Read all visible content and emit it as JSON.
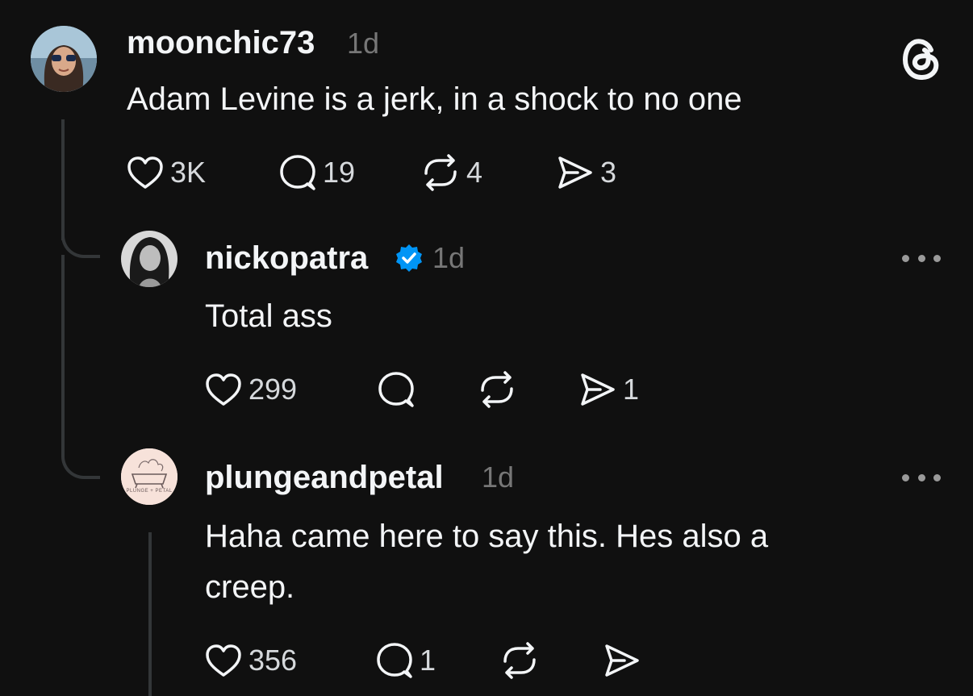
{
  "posts": [
    {
      "username": "moonchic73",
      "time": "1d",
      "text_lines": [
        "Adam Levine is a jerk, in a shock to no one"
      ],
      "likes": "3K",
      "replies": "19",
      "reposts": "4",
      "shares": "3"
    },
    {
      "username": "nickopatra",
      "verified": true,
      "time": "1d",
      "text_lines": [
        "Total ass"
      ],
      "likes": "299",
      "replies": "",
      "reposts": "",
      "shares": "1"
    },
    {
      "username": "plungeandpetal",
      "time": "1d",
      "text_lines": [
        "Haha came here to say this. Hes also a",
        "creep."
      ],
      "likes": "356",
      "replies": "1",
      "reposts": "",
      "shares": ""
    }
  ],
  "avatar_logo_text": "PLUNGE + PETAL",
  "colors": {
    "background": "#101010",
    "text": "#f3f5f7",
    "muted": "#777777",
    "thread_line": "#333638",
    "verified": "#0095f6"
  }
}
